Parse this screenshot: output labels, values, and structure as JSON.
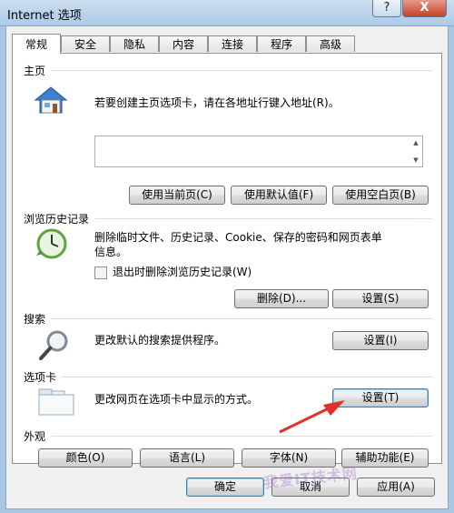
{
  "window": {
    "title": "Internet 选项",
    "help_label": "?",
    "close_label": "X"
  },
  "tabs": [
    "常规",
    "安全",
    "隐私",
    "内容",
    "连接",
    "程序",
    "高级"
  ],
  "home": {
    "title": "主页",
    "description": "若要创建主页选项卡，请在各地址行键入地址(R)。",
    "address_value": "",
    "buttons": {
      "use_current": "使用当前页(C)",
      "use_default": "使用默认值(F)",
      "use_blank": "使用空白页(B)"
    }
  },
  "history": {
    "title": "浏览历史记录",
    "description_line1": "删除临时文件、历史记录、Cookie、保存的密码和网页表单",
    "description_line2": "信息。",
    "checkbox_label": "退出时删除浏览历史记录(W)",
    "checkbox_checked": false,
    "buttons": {
      "delete": "删除(D)...",
      "settings": "设置(S)"
    }
  },
  "search": {
    "title": "搜索",
    "description": "更改默认的搜索提供程序。",
    "buttons": {
      "settings": "设置(I)"
    }
  },
  "tabs_section": {
    "title": "选项卡",
    "description": "更改网页在选项卡中显示的方式。",
    "buttons": {
      "settings": "设置(T)"
    }
  },
  "appearance": {
    "title": "外观",
    "buttons": {
      "colors": "颜色(O)",
      "languages": "语言(L)",
      "fonts": "字体(N)",
      "accessibility": "辅助功能(E)"
    }
  },
  "footer": {
    "ok": "确定",
    "cancel": "取消",
    "apply": "应用(A)"
  },
  "watermark": "我爱IT技术网",
  "colors": {
    "arrow": "#e0312a",
    "title_bar": "#b8d1ea"
  }
}
